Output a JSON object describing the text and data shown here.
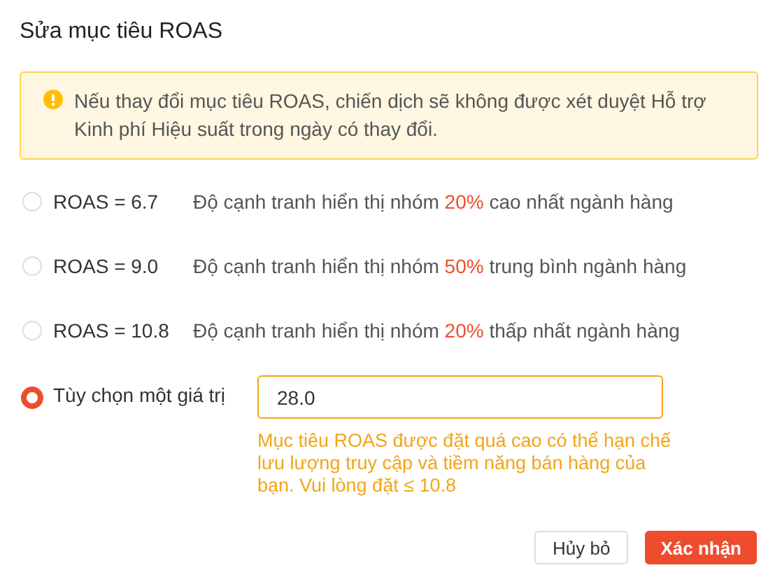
{
  "title": "Sửa mục tiêu ROAS",
  "alert": {
    "text": "Nếu thay đổi mục tiêu ROAS, chiến dịch sẽ không được xét duyệt Hỗ trợ Kinh phí Hiệu suất trong ngày có thay đổi."
  },
  "options": [
    {
      "kind": "preset",
      "label": "ROAS = 6.7",
      "selected": false,
      "description_before": "Độ cạnh tranh hiển thị nhóm",
      "highlight": "20%",
      "description_after": "cao nhất ngành hàng"
    },
    {
      "kind": "preset",
      "label": "ROAS = 9.0",
      "selected": false,
      "description_before": "Độ cạnh tranh hiển thị nhóm",
      "highlight": "50%",
      "description_after": "trung bình ngành hàng"
    },
    {
      "kind": "preset",
      "label": "ROAS = 10.8",
      "selected": false,
      "description_before": "Độ cạnh tranh hiển thị nhóm",
      "highlight": "20%",
      "description_after": "thấp nhất ngành hàng"
    },
    {
      "kind": "custom",
      "label": "Tùy chọn một giá trị",
      "selected": true,
      "value": "28.0",
      "warning": "Mục tiêu ROAS được đặt quá cao có thể hạn chế lưu lượng truy cập và tiềm năng bán hàng của bạn. Vui lòng đặt ≤ 10.8"
    }
  ],
  "buttons": [
    {
      "kind": "secondary",
      "label": "Hủy bỏ"
    },
    {
      "kind": "primary",
      "label": "Xác nhận"
    }
  ]
}
